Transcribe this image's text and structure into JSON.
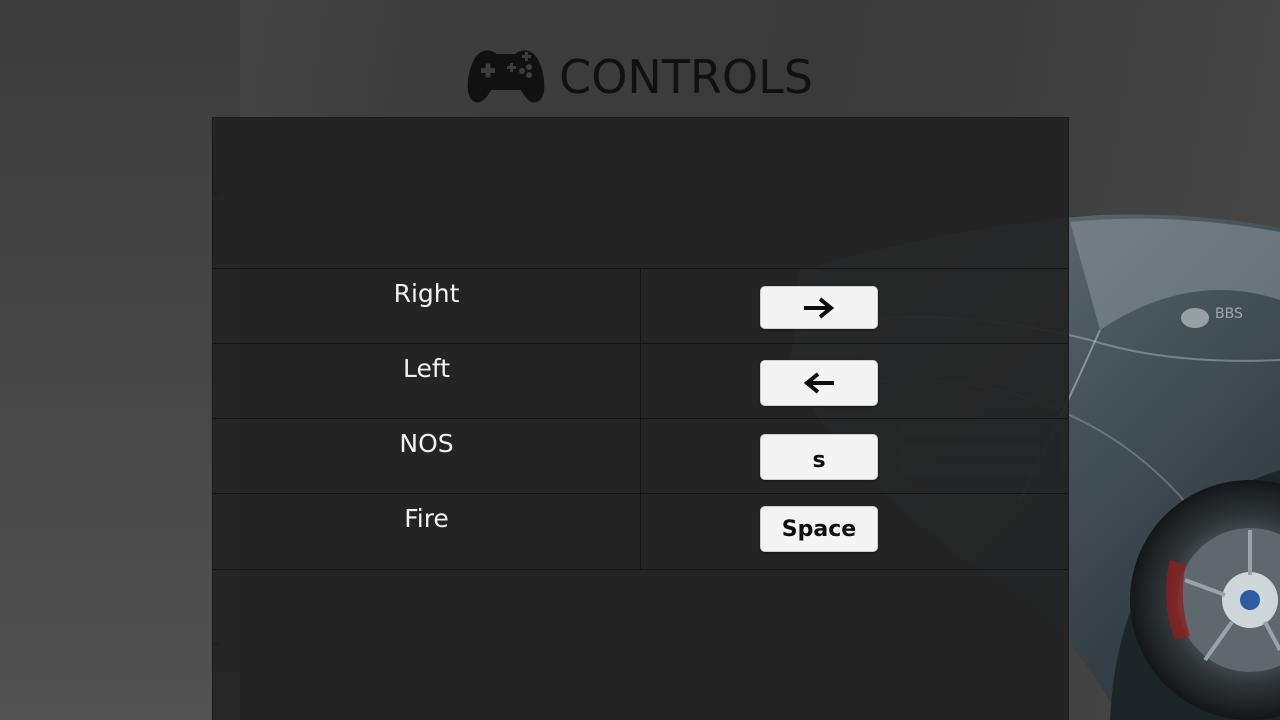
{
  "header": {
    "icon": "gamepad-icon",
    "title": "CONTROLS"
  },
  "controls": [
    {
      "action": "Right",
      "key_label": "",
      "key_icon": "arrow-right-icon"
    },
    {
      "action": "Left",
      "key_label": "",
      "key_icon": "arrow-left-icon"
    },
    {
      "action": "NOS",
      "key_label": "s",
      "key_icon": ""
    },
    {
      "action": "Fire",
      "key_label": "Space",
      "key_icon": ""
    }
  ],
  "colors": {
    "panel": "#222222",
    "text": "#f2f2f2",
    "key_cap": "#f4f4f4",
    "title": "#111111"
  }
}
